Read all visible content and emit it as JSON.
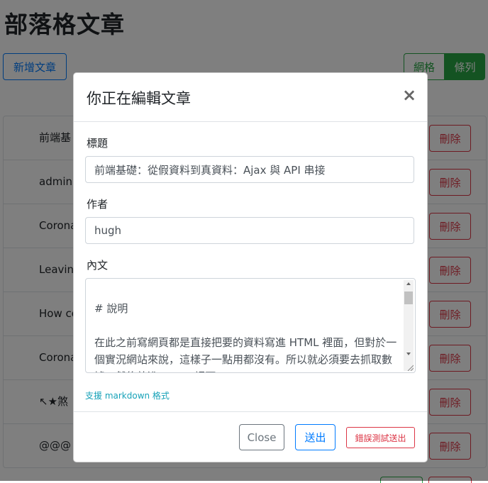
{
  "page": {
    "title": "部落格文章",
    "add_post_label": "新增文章",
    "view_grid_label": "網格",
    "view_list_label": "條列"
  },
  "posts": [
    {
      "title": "前端基",
      "delete_label": "刪除"
    },
    {
      "title": "admin",
      "delete_label": "刪除"
    },
    {
      "title": "Corona",
      "delete_label": "刪除"
    },
    {
      "title": "Leaving",
      "delete_label": "刪除"
    },
    {
      "title": "How co",
      "delete_label": "刪除"
    },
    {
      "title": "Corona",
      "delete_label": "刪除"
    },
    {
      "title": "↖★煞",
      "delete_label": "刪除"
    },
    {
      "title": "@@@",
      "delete_label": "刪除"
    }
  ],
  "modal": {
    "title": "你正在編輯文章",
    "close_icon": "×",
    "title_label": "標題",
    "title_value": "前端基礎：從假資料到真資料：Ajax 與 API 串接",
    "author_label": "作者",
    "author_value": "hugh",
    "content_label": "內文",
    "content_value": "\n# 說明\n\n在此之前寫網頁都是直接把要的資料寫進 HTML 裡面，但對於一個實況網站來說，這樣子一點用都沒有。所以就必須要去抓取數據，然後放進 HTML 裡面。",
    "markdown_hint": "支援 markdown 格式",
    "close_button": "Close",
    "submit_button": "送出",
    "error_test_button": "錯誤測試送出"
  },
  "colors": {
    "primary": "#007bff",
    "success": "#28a745",
    "danger": "#dc3545",
    "info": "#17a2b8",
    "secondary": "#6c757d"
  }
}
